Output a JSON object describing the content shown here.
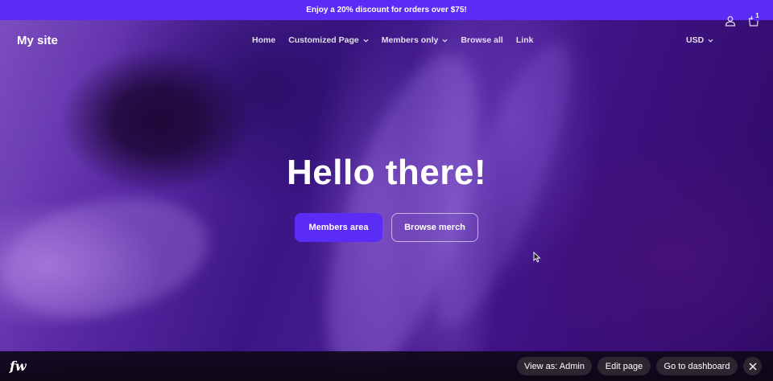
{
  "announcement": {
    "text": "Enjoy a 20% discount for orders over $75!"
  },
  "header": {
    "site_title": "My site",
    "nav": [
      {
        "label": "Home",
        "has_dropdown": false
      },
      {
        "label": "Customized Page",
        "has_dropdown": true
      },
      {
        "label": "Members only",
        "has_dropdown": true
      },
      {
        "label": "Browse all",
        "has_dropdown": false
      },
      {
        "label": "Link",
        "has_dropdown": false
      }
    ],
    "currency": "USD",
    "cart_count": "1"
  },
  "hero": {
    "title": "Hello there!",
    "primary_button": "Members area",
    "secondary_button": "Browse merch"
  },
  "admin_bar": {
    "logo": "fw",
    "view_as": "View as: Admin",
    "edit_page": "Edit page",
    "dashboard": "Go to dashboard"
  },
  "colors": {
    "accent": "#5b2cf6",
    "hero_background": "#3a0f7a",
    "admin_bar": "#0d0716"
  },
  "icons": [
    "chevron-down-icon",
    "user-icon",
    "cart-icon",
    "close-icon",
    "cursor-icon"
  ]
}
